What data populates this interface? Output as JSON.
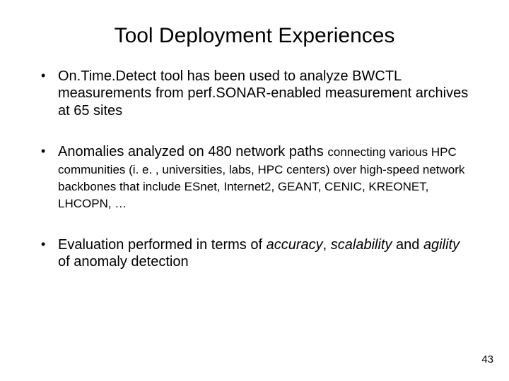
{
  "slide": {
    "title": "Tool Deployment Experiences",
    "pageNumber": "43",
    "bullets": [
      {
        "main": "On.Time.Detect tool has been used to analyze BWCTL measurements from perf.SONAR-enabled measurement archives at 65 sites"
      },
      {
        "main": "Anomalies analyzed on 480 network paths ",
        "sub": "connecting various HPC communities (i. e. , universities, labs, HPC centers) over high-speed network backbones that include ESnet, Internet2, GEANT, CENIC, KREONET, LHCOPN, …"
      },
      {
        "pre": "Evaluation performed in terms of ",
        "em1": "accuracy",
        "mid1": ", ",
        "em2": "scalability",
        "mid2": " and ",
        "em3": "agility",
        "post": " of anomaly detection"
      }
    ]
  }
}
